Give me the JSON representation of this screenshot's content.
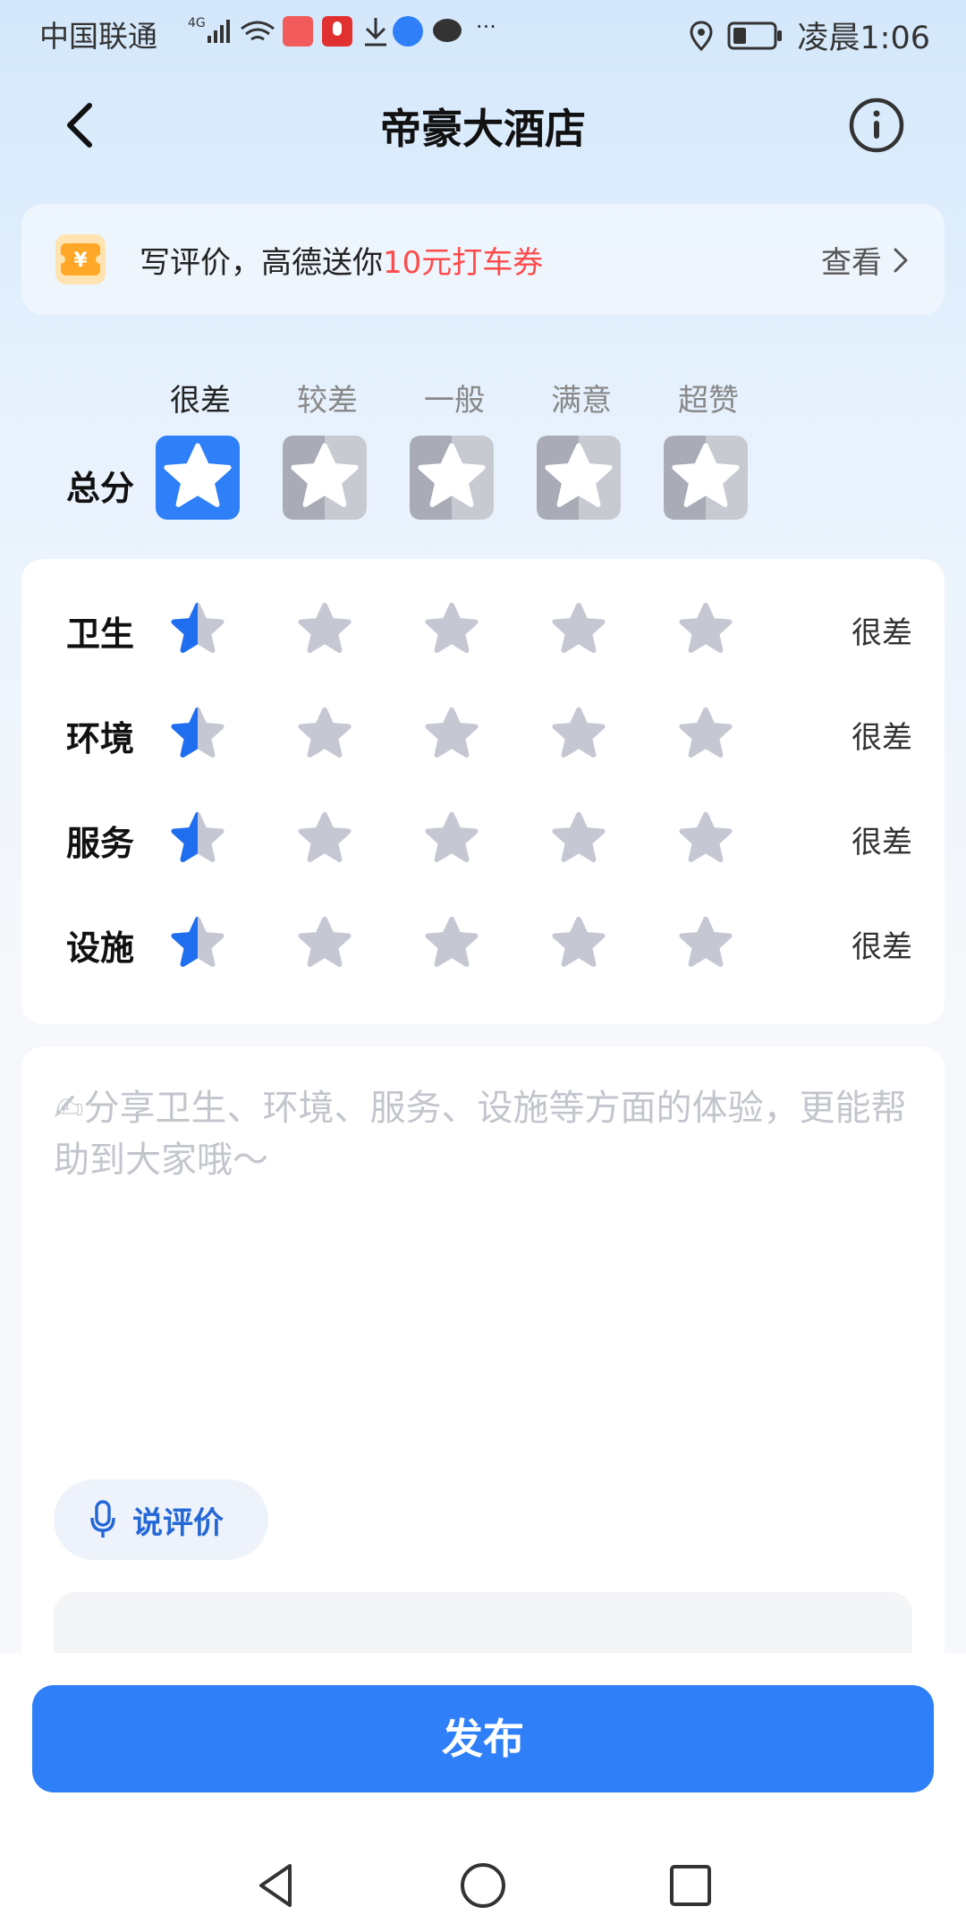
{
  "status_bar": {
    "carrier": "中国联通",
    "network": "4G",
    "time": "凌晨1:06"
  },
  "header": {
    "title": "帝豪大酒店",
    "back_icon": "chevron-left-icon",
    "info_icon": "info-icon"
  },
  "promo": {
    "text_prefix": "写评价，高德送你",
    "text_highlight": "10元打车券",
    "link_label": "查看",
    "highlight_color": "#ff4a4a"
  },
  "rating": {
    "levels": [
      "很差",
      "较差",
      "一般",
      "满意",
      "超赞"
    ],
    "total_label": "总分",
    "total_score": 1,
    "max_score": 5,
    "categories": [
      {
        "label": "卫生",
        "score": 0.5,
        "value_text": "很差"
      },
      {
        "label": "环境",
        "score": 0.5,
        "value_text": "很差"
      },
      {
        "label": "服务",
        "score": 0.5,
        "value_text": "很差"
      },
      {
        "label": "设施",
        "score": 0.5,
        "value_text": "很差"
      }
    ]
  },
  "comment": {
    "placeholder": "✍分享卫生、环境、服务、设施等方面的体验，更能帮助到大家哦～",
    "voice_label": "说评价"
  },
  "publish_label": "发布",
  "colors": {
    "accent": "#2e7ff8",
    "star_inactive": "#c5c8d2",
    "star_active": "#1f6ef0"
  }
}
